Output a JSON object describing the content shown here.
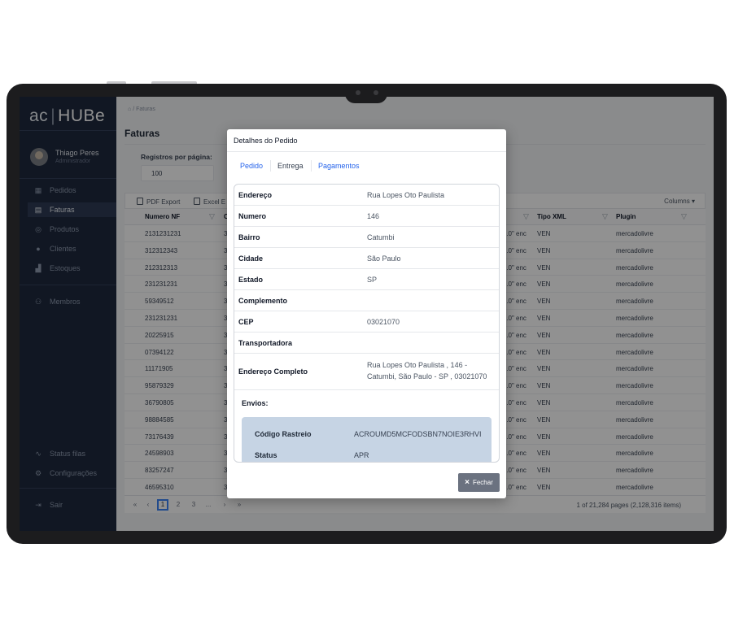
{
  "app": {
    "logo_left": "ac",
    "logo_right": "HUBe",
    "user_name": "Thiago Peres",
    "user_role": "Administrador"
  },
  "sidebar": {
    "items": [
      {
        "label": "Pedidos",
        "icon": "grid-icon"
      },
      {
        "label": "Faturas",
        "icon": "invoice-icon"
      },
      {
        "label": "Produtos",
        "icon": "package-icon"
      },
      {
        "label": "Clientes",
        "icon": "user-icon"
      },
      {
        "label": "Estoques",
        "icon": "boxes-icon"
      },
      {
        "label": "Membros",
        "icon": "users-icon"
      }
    ],
    "bottom": [
      {
        "label": "Status filas",
        "icon": "pulse-icon"
      },
      {
        "label": "Configurações",
        "icon": "gear-icon"
      },
      {
        "label": "Sair",
        "icon": "logout-icon"
      }
    ]
  },
  "breadcrumb": {
    "home_icon": "⌂",
    "sep": "/",
    "page": "Faturas"
  },
  "page": {
    "title": "Faturas",
    "rpp_label": "Registros por página:",
    "rpp_value": "100"
  },
  "toolbar": {
    "pdf": "PDF Export",
    "excel": "Excel E",
    "columns": "Columns"
  },
  "grid": {
    "headers": [
      "Numero NF",
      "C",
      "Tipo XML",
      "Plugin"
    ],
    "rows": [
      {
        "nf": "2131231231",
        "c": "3",
        "xml": "\"1.0\" enc",
        "tipo": "VEN",
        "plugin": "mercadolivre"
      },
      {
        "nf": "312312343",
        "c": "3",
        "xml": "\"1.0\" enc",
        "tipo": "VEN",
        "plugin": "mercadolivre"
      },
      {
        "nf": "212312313",
        "c": "3",
        "xml": "\"1.0\" enc",
        "tipo": "VEN",
        "plugin": "mercadolivre"
      },
      {
        "nf": "231231231",
        "c": "3",
        "xml": "\"1.0\" enc",
        "tipo": "VEN",
        "plugin": "mercadolivre"
      },
      {
        "nf": "59349512",
        "c": "3",
        "xml": "\"1.0\" enc",
        "tipo": "VEN",
        "plugin": "mercadolivre"
      },
      {
        "nf": "231231231",
        "c": "3",
        "xml": "\"1.0\" enc",
        "tipo": "VEN",
        "plugin": "mercadolivre"
      },
      {
        "nf": "20225915",
        "c": "3",
        "xml": "\"1.0\" enc",
        "tipo": "VEN",
        "plugin": "mercadolivre"
      },
      {
        "nf": "07394122",
        "c": "3",
        "xml": "\"1.0\" enc",
        "tipo": "VEN",
        "plugin": "mercadolivre"
      },
      {
        "nf": "11171905",
        "c": "3",
        "xml": "\"1.0\" enc",
        "tipo": "VEN",
        "plugin": "mercadolivre"
      },
      {
        "nf": "95879329",
        "c": "3",
        "xml": "\"1.0\" enc",
        "tipo": "VEN",
        "plugin": "mercadolivre"
      },
      {
        "nf": "36790805",
        "c": "3",
        "xml": "\"1.0\" enc",
        "tipo": "VEN",
        "plugin": "mercadolivre"
      },
      {
        "nf": "98884585",
        "c": "3",
        "xml": "\"1.0\" enc",
        "tipo": "VEN",
        "plugin": "mercadolivre"
      },
      {
        "nf": "73176439",
        "c": "3",
        "xml": "\"1.0\" enc",
        "tipo": "VEN",
        "plugin": "mercadolivre"
      },
      {
        "nf": "24598903",
        "c": "3",
        "xml": "\"1.0\" enc",
        "tipo": "VEN",
        "plugin": "mercadolivre"
      },
      {
        "nf": "83257247",
        "c": "3",
        "xml": "\"1.0\" enc",
        "tipo": "VEN",
        "plugin": "mercadolivre"
      },
      {
        "nf": "46595310",
        "c": "3",
        "xml": "\"1.0\" enc",
        "tipo": "VEN",
        "plugin": "mercadolivre"
      }
    ]
  },
  "pager": {
    "first": "«",
    "prev": "‹",
    "pages": [
      "1",
      "2",
      "3",
      "..."
    ],
    "next": "›",
    "last": "»",
    "info": "1 of 21,284 pages (2,128,316 items)"
  },
  "modal": {
    "title": "Detalhes do Pedido",
    "tabs": [
      "Pedido",
      "Entrega",
      "Pagamentos"
    ],
    "fields": [
      {
        "label": "Endereço",
        "value": "Rua Lopes Oto Paulista"
      },
      {
        "label": "Numero",
        "value": "146"
      },
      {
        "label": "Bairro",
        "value": "Catumbi"
      },
      {
        "label": "Cidade",
        "value": "São Paulo"
      },
      {
        "label": "Estado",
        "value": "SP"
      },
      {
        "label": "Complemento",
        "value": ""
      },
      {
        "label": "CEP",
        "value": "03021070"
      },
      {
        "label": "Transportadora",
        "value": ""
      },
      {
        "label": "Endereço Completo",
        "value": "Rua Lopes Oto Paulista , 146 - Catumbi, São Paulo - SP , 03021070"
      }
    ],
    "envios_label": "Envios:",
    "envio": {
      "codigo_label": "Código Rastreio",
      "codigo_value": "ACROUMD5MCFODSBN7NOIE3RHVI",
      "status_label": "Status",
      "status_value": "APR"
    },
    "close_label": "Fechar"
  },
  "colors": {
    "sidebar": "#1f2a3e",
    "accent": "#3b82f6",
    "tab_link": "#2563eb",
    "envio_box": "#c6d4e4",
    "close_button": "#6b7280"
  }
}
